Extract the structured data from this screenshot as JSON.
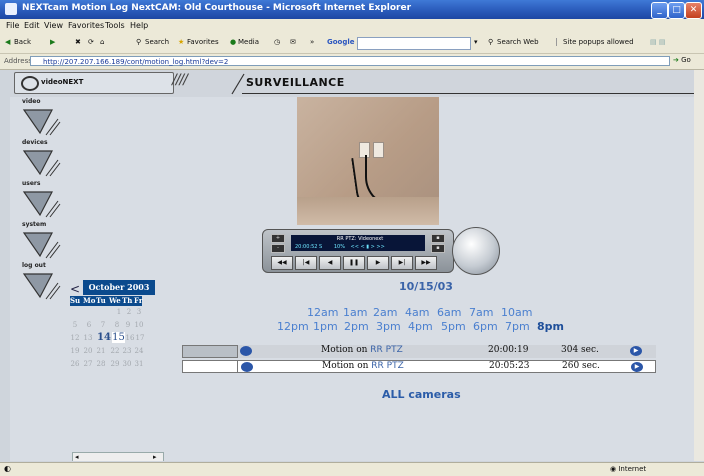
{
  "window": {
    "title": "NEXTcam Motion Log NextCAM: Old Courthouse - Microsoft Internet Explorer"
  },
  "menu": [
    "File",
    "Edit",
    "View",
    "Favorites",
    "Tools",
    "Help"
  ],
  "toolbar": {
    "back": "Back",
    "search": "Search",
    "favorites": "Favorites",
    "media": "Media",
    "google": "Google",
    "search_web": "Search Web",
    "popups": "Site popups allowed"
  },
  "address": {
    "label": "Address",
    "url": "http://207.207.166.189/cont/motion_log.html?dev=2",
    "go": "Go"
  },
  "header": {
    "logo": "videoNEXT",
    "section": "SURVEILLANCE"
  },
  "nav": [
    {
      "label": "video"
    },
    {
      "label": "devices"
    },
    {
      "label": "users"
    },
    {
      "label": "system"
    },
    {
      "label": "log out"
    }
  ],
  "controller": {
    "lcd_title": "RR PTZ: Videonext",
    "lcd_time": "20:00:52 S",
    "lcd_zoom": "10%"
  },
  "date": "10/15/03",
  "hours_row1": [
    "12am",
    "1am",
    "2am",
    "4am",
    "6am",
    "7am",
    "10am"
  ],
  "hours_row2": [
    "12pm",
    "1pm",
    "2pm",
    "3pm",
    "4pm",
    "5pm",
    "6pm",
    "7pm"
  ],
  "hours_current": "8pm",
  "calendar": {
    "prev": "<",
    "month": "October 2003",
    "dow": [
      "Su",
      "Mo",
      "Tu",
      "We",
      "Th",
      "Fr"
    ],
    "days": [
      "1",
      "2",
      "3",
      "5",
      "6",
      "7",
      "8",
      "9",
      "10",
      "12",
      "13",
      "14",
      "15",
      "16",
      "17",
      "19",
      "20",
      "21",
      "22",
      "23",
      "24",
      "26",
      "27",
      "28",
      "29",
      "30",
      "31"
    ],
    "selected": "14",
    "today": "15"
  },
  "events": [
    {
      "text": "Motion on ",
      "camera": "RR PTZ",
      "time": "20:00:19",
      "duration": "304 sec."
    },
    {
      "text": "Motion on ",
      "camera": "RR PTZ",
      "time": "20:05:23",
      "duration": "260 sec."
    }
  ],
  "all_cameras": "ALL cameras",
  "status": {
    "zone": "Internet"
  },
  "colors": {
    "accent": "#0b4a8d",
    "link": "#3a63a8",
    "title_bar": "#2858b8"
  }
}
